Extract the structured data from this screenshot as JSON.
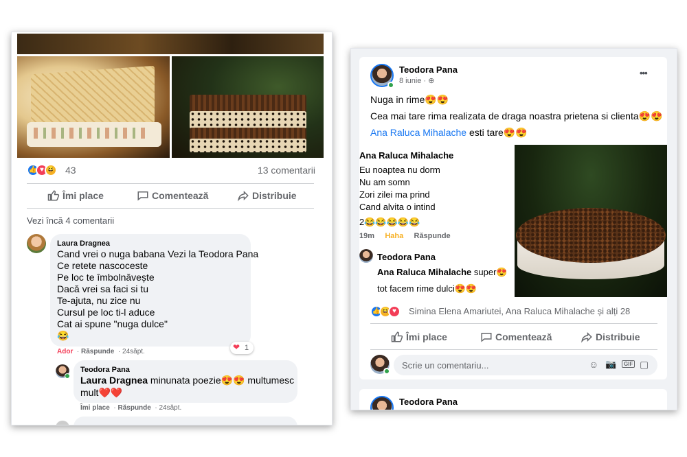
{
  "left_post": {
    "reactions_count": "43",
    "comments_count": "13 comentarii",
    "actions": {
      "like": "Îmi place",
      "comment": "Comentează",
      "share": "Distribuie"
    },
    "view_more": "Vezi încă 4 comentarii",
    "comment1": {
      "author": "Laura Dragnea",
      "lines": [
        "Cand vrei o nuga babana Vezi la Teodora Pana",
        "Ce retete nascoceste",
        "Pe loc te îmbolnăvește",
        "Dacă vrei sa faci si tu",
        "Te-ajuta, nu zice nu",
        "Cursul pe loc ti-l aduce",
        "Cat ai spune \"nuga dulce\"",
        "😂"
      ],
      "reaction_count": "1",
      "meta_reaction": "Ador",
      "meta_reply": "Răspunde",
      "meta_time": "24săpt."
    },
    "reply1": {
      "author": "Teodora Pana",
      "mention": "Laura Dragnea",
      "text": " minunata poezie😍😍 multumesc",
      "text2": "mult❤️❤️",
      "meta_like": "Îmi place",
      "meta_reply": "Răspunde",
      "meta_time": "24săpt."
    }
  },
  "right_post": {
    "author": "Teodora Pana",
    "date": "8 iunie",
    "more": "•••",
    "text_line1": "Nuga in rime😍😍",
    "text_line2": "Cea mai tare rima realizata de draga noastra prietena si clienta😍😍",
    "mention": "Ana Raluca Mihalache",
    "text_line3": " esti tare😍😍",
    "embedded": {
      "author": "Ana Raluca Mihalache",
      "lines": [
        "Eu noaptea nu dorm",
        "Nu am somn",
        "Zori zilei ma prind",
        "Cand alvita o intind",
        "2😂😂😂😂😂"
      ],
      "meta_time": "19m",
      "meta_reaction": "Haha",
      "meta_reply": "Răspunde",
      "reply_author": "Teodora Pana",
      "reply_mention": "Ana Raluca Mihalache",
      "reply_text": " super😍",
      "reply_text2": "tot facem rime dulci😍😍"
    },
    "reactors": "Simina Elena Amariutei, Ana Raluca Mihalache și alți 28",
    "actions": {
      "like": "Îmi place",
      "comment": "Comentează",
      "share": "Distribuie"
    },
    "comment_placeholder": "Scrie un comentariu...",
    "next_post_author": "Teodora Pana"
  },
  "colors": {
    "fb_blue": "#1877f2",
    "love_red": "#f33e58",
    "haha_yellow": "#f7b125",
    "gray_text": "#65676b",
    "ador_red": "#f33e58"
  }
}
